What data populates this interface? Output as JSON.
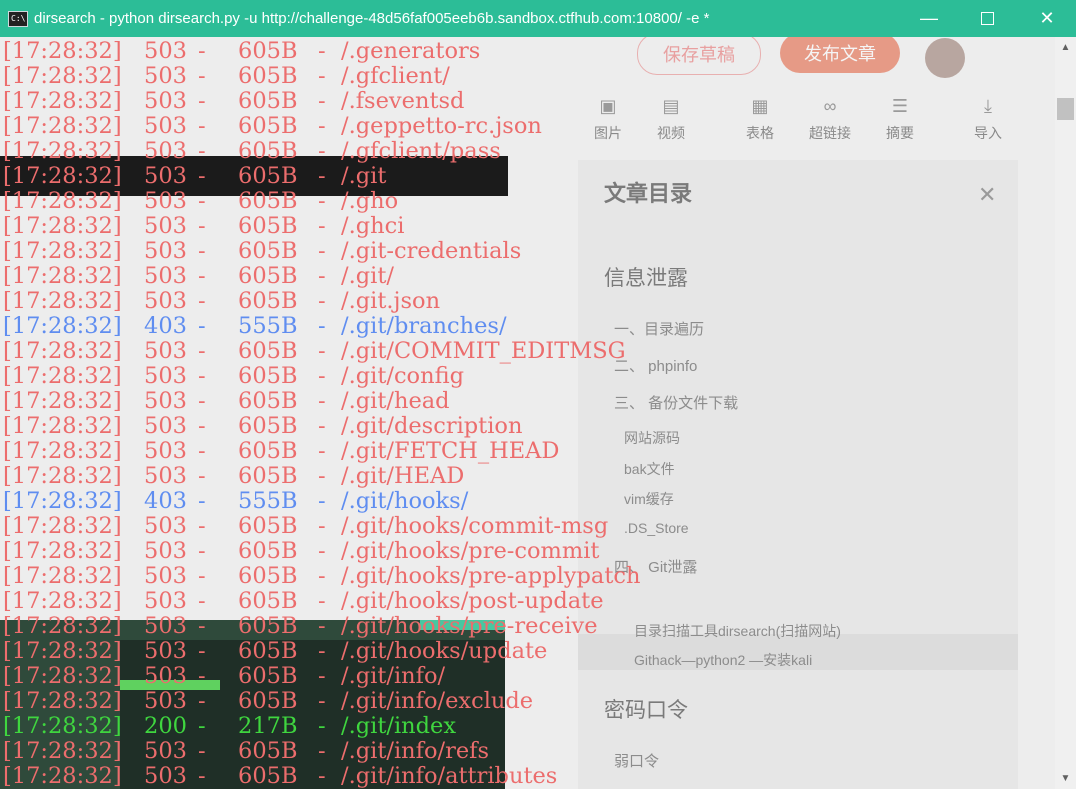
{
  "window": {
    "title": "dirsearch - python  dirsearch.py -u http://challenge-48d56faf005eeb6b.sandbox.ctfhub.com:10800/ -e *",
    "minimize": "—",
    "close": "✕"
  },
  "background": {
    "save_draft": "保存草稿",
    "publish": "发布文章",
    "toolbar": [
      {
        "label": "图片",
        "icon": "image-icon"
      },
      {
        "label": "视频",
        "icon": "video-icon"
      },
      {
        "label": "表格",
        "icon": "table-icon"
      },
      {
        "label": "超链接",
        "icon": "link-icon"
      },
      {
        "label": "摘要",
        "icon": "summary-icon"
      },
      {
        "label": "导入",
        "icon": "import-icon"
      }
    ],
    "toc": {
      "title": "文章目录",
      "sections": [
        {
          "heading": "信息泄露",
          "items": [
            "一、目录遍历",
            "二、 phpinfo",
            "三、 备份文件下载",
            "网站源码",
            "bak文件",
            "vim缓存",
            ".DS_Store",
            "四、 Git泄露",
            "目录扫描工具dirsearch(扫描网站)",
            "Githack—python2 —安装kali"
          ]
        },
        {
          "heading": "密码口令",
          "items": [
            "弱口令"
          ]
        }
      ]
    }
  },
  "colors": {
    "red": "#ec6d6d",
    "blue": "#5f8df0",
    "green": "#3fd63f",
    "titlebar": "#2cbd97"
  },
  "console_lines": [
    {
      "time": "[17:28:32]",
      "status": "503",
      "size": "605B",
      "path": "/.generators",
      "color": "red"
    },
    {
      "time": "[17:28:32]",
      "status": "503",
      "size": "605B",
      "path": "/.gfclient/",
      "color": "red"
    },
    {
      "time": "[17:28:32]",
      "status": "503",
      "size": "605B",
      "path": "/.fseventsd",
      "color": "red"
    },
    {
      "time": "[17:28:32]",
      "status": "503",
      "size": "605B",
      "path": "/.geppetto-rc.json",
      "color": "red"
    },
    {
      "time": "[17:28:32]",
      "status": "503",
      "size": "605B",
      "path": "/.gfclient/pass",
      "color": "red"
    },
    {
      "time": "[17:28:32]",
      "status": "503",
      "size": "605B",
      "path": "/.git",
      "color": "red"
    },
    {
      "time": "[17:28:32]",
      "status": "503",
      "size": "605B",
      "path": "/.gho",
      "color": "red"
    },
    {
      "time": "[17:28:32]",
      "status": "503",
      "size": "605B",
      "path": "/.ghci",
      "color": "red"
    },
    {
      "time": "[17:28:32]",
      "status": "503",
      "size": "605B",
      "path": "/.git-credentials",
      "color": "red"
    },
    {
      "time": "[17:28:32]",
      "status": "503",
      "size": "605B",
      "path": "/.git/",
      "color": "red"
    },
    {
      "time": "[17:28:32]",
      "status": "503",
      "size": "605B",
      "path": "/.git.json",
      "color": "red"
    },
    {
      "time": "[17:28:32]",
      "status": "403",
      "size": "555B",
      "path": "/.git/branches/",
      "color": "blue"
    },
    {
      "time": "[17:28:32]",
      "status": "503",
      "size": "605B",
      "path": "/.git/COMMIT_EDITMSG",
      "color": "red"
    },
    {
      "time": "[17:28:32]",
      "status": "503",
      "size": "605B",
      "path": "/.git/config",
      "color": "red"
    },
    {
      "time": "[17:28:32]",
      "status": "503",
      "size": "605B",
      "path": "/.git/head",
      "color": "red"
    },
    {
      "time": "[17:28:32]",
      "status": "503",
      "size": "605B",
      "path": "/.git/description",
      "color": "red"
    },
    {
      "time": "[17:28:32]",
      "status": "503",
      "size": "605B",
      "path": "/.git/FETCH_HEAD",
      "color": "red"
    },
    {
      "time": "[17:28:32]",
      "status": "503",
      "size": "605B",
      "path": "/.git/HEAD",
      "color": "red"
    },
    {
      "time": "[17:28:32]",
      "status": "403",
      "size": "555B",
      "path": "/.git/hooks/",
      "color": "blue"
    },
    {
      "time": "[17:28:32]",
      "status": "503",
      "size": "605B",
      "path": "/.git/hooks/commit-msg",
      "color": "red"
    },
    {
      "time": "[17:28:32]",
      "status": "503",
      "size": "605B",
      "path": "/.git/hooks/pre-commit",
      "color": "red"
    },
    {
      "time": "[17:28:32]",
      "status": "503",
      "size": "605B",
      "path": "/.git/hooks/pre-applypatch",
      "color": "red"
    },
    {
      "time": "[17:28:32]",
      "status": "503",
      "size": "605B",
      "path": "/.git/hooks/post-update",
      "color": "red"
    },
    {
      "time": "[17:28:32]",
      "status": "503",
      "size": "605B",
      "path": "/.git/hooks/pre-receive",
      "color": "red"
    },
    {
      "time": "[17:28:32]",
      "status": "503",
      "size": "605B",
      "path": "/.git/hooks/update",
      "color": "red"
    },
    {
      "time": "[17:28:32]",
      "status": "503",
      "size": "605B",
      "path": "/.git/info/",
      "color": "red"
    },
    {
      "time": "[17:28:32]",
      "status": "503",
      "size": "605B",
      "path": "/.git/info/exclude",
      "color": "red"
    },
    {
      "time": "[17:28:32]",
      "status": "200",
      "size": "217B",
      "path": "/.git/index",
      "color": "green"
    },
    {
      "time": "[17:28:32]",
      "status": "503",
      "size": "605B",
      "path": "/.git/info/refs",
      "color": "red"
    },
    {
      "time": "[17:28:32]",
      "status": "503",
      "size": "605B",
      "path": "/.git/info/attributes",
      "color": "red"
    }
  ]
}
